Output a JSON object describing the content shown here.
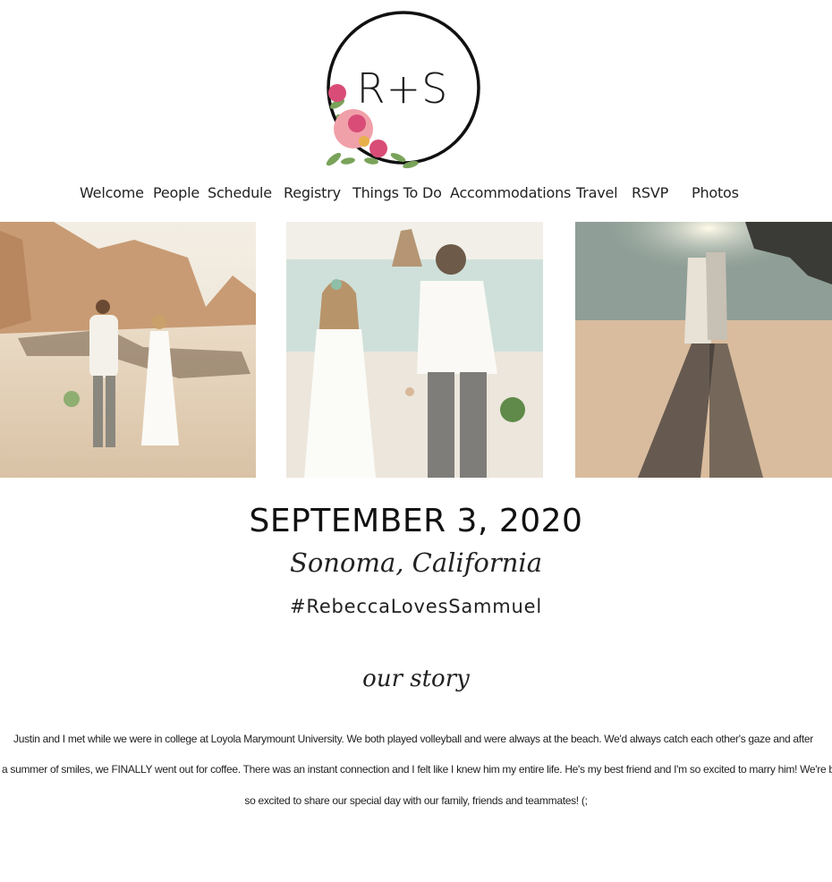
{
  "logo": {
    "monogram": "R+S",
    "icon": "floral-wreath-icon"
  },
  "nav": {
    "items": [
      {
        "label": "Welcome"
      },
      {
        "label": "People"
      },
      {
        "label": "Schedule"
      },
      {
        "label": "Registry"
      },
      {
        "label": "Things To Do"
      },
      {
        "label": "Accommodations"
      },
      {
        "label": "Travel"
      },
      {
        "label": "RSVP"
      },
      {
        "label": "Photos"
      }
    ]
  },
  "event": {
    "date": "SEPTEMBER 3, 2020",
    "location": "Sonoma, California",
    "hashtag": "#RebeccaLovesSammuel"
  },
  "story": {
    "heading": "our story",
    "lines": [
      "Justin and I met while we were in college at Loyola Marymount University. We both played volleyball and  were always at the beach. We'd always catch each other's gaze and after",
      "a summer of smiles,  we FINALLY went out for coffee. There was an instant connection and I felt like I knew him my entire life. He's my best friend and I'm so excited to marry him! We're both",
      "so excited to share our special day with  our family, friends and teammates! (;"
    ]
  },
  "colors": {
    "background": "#ffffff",
    "text": "#1b1b1b",
    "flower_pink": "#d94c78",
    "flower_light": "#f0a0a8",
    "leaf": "#7aa35a",
    "sand": "#e8d3b8"
  }
}
